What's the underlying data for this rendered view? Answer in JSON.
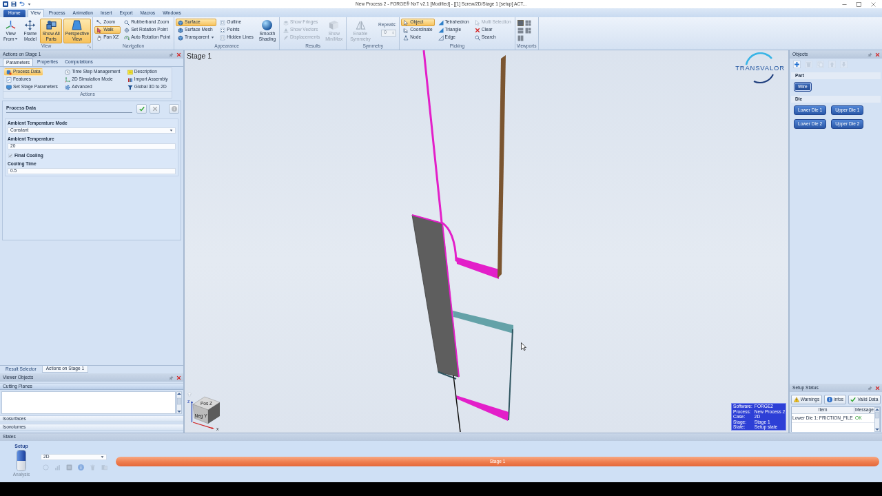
{
  "window": {
    "title": "New Process 2 - FORGE® NxT v2.1 [Modified] - [[1] Screw/2D/Stage 1 [setup] ACT..."
  },
  "ribbon_tabs": [
    {
      "label": "Home",
      "kind": "app",
      "selected": false
    },
    {
      "label": "View",
      "kind": "tab",
      "selected": true
    },
    {
      "label": "Process",
      "kind": "tab",
      "selected": false
    },
    {
      "label": "Animation",
      "kind": "tab",
      "selected": false
    },
    {
      "label": "Insert",
      "kind": "tab",
      "selected": false
    },
    {
      "label": "Export",
      "kind": "tab",
      "selected": false
    },
    {
      "label": "Macros",
      "kind": "tab",
      "selected": false
    },
    {
      "label": "Windows",
      "kind": "tab",
      "selected": false
    }
  ],
  "ribbon_groups": [
    {
      "label": "View",
      "launcher": true,
      "columns": [
        {
          "kind": "large",
          "label": "View\nFrom",
          "dropdown": true,
          "selected": false,
          "disabled": false
        },
        {
          "kind": "large",
          "label": "Frame\nModel",
          "selected": false,
          "disabled": false
        },
        {
          "kind": "large",
          "label": "Show All\nParts",
          "selected": true,
          "disabled": false
        },
        {
          "kind": "large",
          "label": "Perspective\nView",
          "selected": true,
          "disabled": false
        }
      ]
    },
    {
      "label": "Navigation",
      "columns": [
        {
          "kind": "stack",
          "items": [
            {
              "label": "Zoom",
              "selected": false,
              "disabled": false
            },
            {
              "label": "Walk",
              "selected": true,
              "disabled": false
            },
            {
              "label": "Pan XZ",
              "selected": false,
              "disabled": false
            }
          ]
        },
        {
          "kind": "stack",
          "items": [
            {
              "label": "Rubberband Zoom",
              "selected": false,
              "disabled": false
            },
            {
              "label": "Set Rotation Point",
              "selected": false,
              "disabled": false
            },
            {
              "label": "Auto Rotation Point",
              "selected": false,
              "disabled": false
            }
          ]
        }
      ]
    },
    {
      "label": "Appearance",
      "columns": [
        {
          "kind": "stack",
          "items": [
            {
              "label": "Surface",
              "selected": true,
              "disabled": false
            },
            {
              "label": "Surface Mesh",
              "selected": false,
              "disabled": false
            },
            {
              "label": "Transparent",
              "dropdown": true,
              "selected": false,
              "disabled": false
            }
          ]
        },
        {
          "kind": "stack",
          "items": [
            {
              "label": "Outline",
              "selected": false,
              "disabled": false
            },
            {
              "label": "Points",
              "selected": false,
              "disabled": false
            },
            {
              "label": "Hidden Lines",
              "selected": false,
              "disabled": false
            }
          ]
        },
        {
          "kind": "large",
          "label": "Smooth\nShading",
          "selected": false,
          "disabled": false
        }
      ]
    },
    {
      "label": "Results",
      "columns": [
        {
          "kind": "stack",
          "items": [
            {
              "label": "Show Fringes",
              "selected": false,
              "disabled": true
            },
            {
              "label": "Show Vectors",
              "selected": false,
              "disabled": true
            },
            {
              "label": "Displacements",
              "selected": false,
              "disabled": true
            }
          ]
        },
        {
          "kind": "large",
          "label": "Show\nMin/Max",
          "selected": false,
          "disabled": true
        }
      ]
    },
    {
      "label": "Symmetry",
      "columns": [
        {
          "kind": "large",
          "label": "Enable\nSymmetry",
          "selected": false,
          "disabled": true
        },
        {
          "kind": "spinner",
          "label": "Repeats:",
          "value": "0",
          "disabled": true
        }
      ]
    },
    {
      "label": "Picking",
      "columns": [
        {
          "kind": "stack",
          "items": [
            {
              "label": "Object",
              "selected": true,
              "disabled": false
            },
            {
              "label": "Coordinate",
              "selected": false,
              "disabled": false
            },
            {
              "label": "Node",
              "selected": false,
              "disabled": false
            }
          ]
        },
        {
          "kind": "stack",
          "items": [
            {
              "label": "Tetrahedron",
              "selected": false,
              "disabled": false
            },
            {
              "label": "Triangle",
              "selected": false,
              "disabled": false
            },
            {
              "label": "Edge",
              "selected": false,
              "disabled": false
            }
          ]
        },
        {
          "kind": "stack",
          "items": [
            {
              "label": "Multi Selection",
              "selected": false,
              "disabled": true
            },
            {
              "label": "Clear",
              "selected": false,
              "disabled": false
            },
            {
              "label": "Search",
              "selected": false,
              "disabled": false
            }
          ]
        }
      ]
    },
    {
      "label": "Viewports",
      "columns": [
        {
          "kind": "tiles",
          "items": [
            {
              "selected": true
            },
            {
              "selected": false
            },
            {
              "selected": false
            },
            {
              "selected": false
            },
            {
              "selected": false
            }
          ]
        }
      ]
    }
  ],
  "actions_panel": {
    "title": "Actions on Stage 1",
    "tabs": [
      {
        "label": "Parameters",
        "selected": true
      },
      {
        "label": "Properties",
        "selected": false
      },
      {
        "label": "Computations",
        "selected": false
      }
    ],
    "actions": {
      "label": "Actions",
      "items": [
        {
          "label": "Process Data",
          "selected": true
        },
        {
          "label": "Time Step Management",
          "selected": false
        },
        {
          "label": "Description",
          "selected": false
        },
        {
          "label": "Features",
          "selected": false
        },
        {
          "label": "2D Simulation Mode",
          "selected": false
        },
        {
          "label": "Import Assembly",
          "selected": false
        },
        {
          "label": "Set Stage Parameters",
          "selected": false
        },
        {
          "label": "Advanced",
          "selected": false
        },
        {
          "label": "Global 3D to 2D",
          "selected": false
        }
      ]
    },
    "process_data": {
      "title": "Process Data",
      "buttons": [
        {
          "kind": "apply",
          "disabled": false
        },
        {
          "kind": "cancel",
          "disabled": true
        },
        {
          "kind": "info",
          "disabled": true
        }
      ],
      "fields": [
        {
          "kind": "select",
          "label": "Ambient Temperature Mode",
          "value": "Constant"
        },
        {
          "kind": "input",
          "label": "Ambient Temperature",
          "value": "20"
        },
        {
          "kind": "checkbox",
          "label": "Final Cooling",
          "checked": true
        },
        {
          "kind": "input",
          "label": "Cooling Time",
          "value": "0.5"
        }
      ]
    },
    "bottom_tabs": [
      {
        "label": "Result Selector",
        "selected": false
      },
      {
        "label": "Actions on Stage 1",
        "selected": true
      }
    ]
  },
  "viewer_objects": {
    "title": "Viewer Objects",
    "sections": [
      {
        "label": "Cutting Planes",
        "expanded": true
      },
      {
        "label": "Isosurfaces",
        "expanded": false
      },
      {
        "label": "Isovolumes",
        "expanded": false
      }
    ]
  },
  "viewport": {
    "title": "Stage 1",
    "logo": "TRANSVALOR",
    "view_cube": {
      "top": "Pos Z",
      "front": "Neg Y",
      "axes": [
        "z",
        "x"
      ]
    },
    "info": [
      {
        "label": "Software:",
        "value": "FORGE2"
      },
      {
        "label": "Process:",
        "value": "New Process 2"
      },
      {
        "label": "Case:",
        "value": "2D"
      },
      {
        "label": "Stage:",
        "value": "Stage 1"
      },
      {
        "label": "State:",
        "value": "Setup state"
      }
    ]
  },
  "objects_panel": {
    "title": "Objects",
    "toolbar": [
      {
        "kind": "add",
        "disabled": false
      },
      {
        "kind": "delete",
        "disabled": true
      },
      {
        "kind": "copy",
        "disabled": true
      },
      {
        "kind": "move_up",
        "disabled": true
      },
      {
        "kind": "move_down",
        "disabled": true
      }
    ],
    "groups": [
      {
        "label": "Part",
        "objects": [
          {
            "label": "Wire",
            "selected": true
          }
        ]
      },
      {
        "label": "Die",
        "objects": [
          {
            "label": "Lower Die 1",
            "selected": false
          },
          {
            "label": "Upper Die 1",
            "selected": false
          },
          {
            "label": "Lower Die 2",
            "selected": false
          },
          {
            "label": "Upper Die 2",
            "selected": false
          }
        ]
      }
    ]
  },
  "setup_status": {
    "title": "Setup Status",
    "filters": [
      {
        "kind": "warning",
        "label": "Warnings"
      },
      {
        "kind": "info",
        "label": "Infos"
      },
      {
        "kind": "valid",
        "label": "Valid Data"
      }
    ],
    "columns": [
      "Item",
      "Message"
    ],
    "rows": [
      {
        "item": "Lower Die 1: FRICTION_FILE",
        "message": "OK"
      }
    ]
  },
  "states": {
    "title": "States",
    "modes": [
      {
        "label": "Setup",
        "selected": true
      },
      {
        "label": "Analysis",
        "selected": false
      }
    ],
    "case": "2D",
    "tools": [
      {
        "kind": "run",
        "disabled": true
      },
      {
        "kind": "chart",
        "disabled": true
      },
      {
        "kind": "stop",
        "disabled": true
      },
      {
        "kind": "info",
        "disabled": true
      },
      {
        "kind": "delete",
        "disabled": true
      },
      {
        "kind": "compare",
        "disabled": true
      }
    ],
    "stages": [
      {
        "label": "Stage 1"
      }
    ]
  }
}
